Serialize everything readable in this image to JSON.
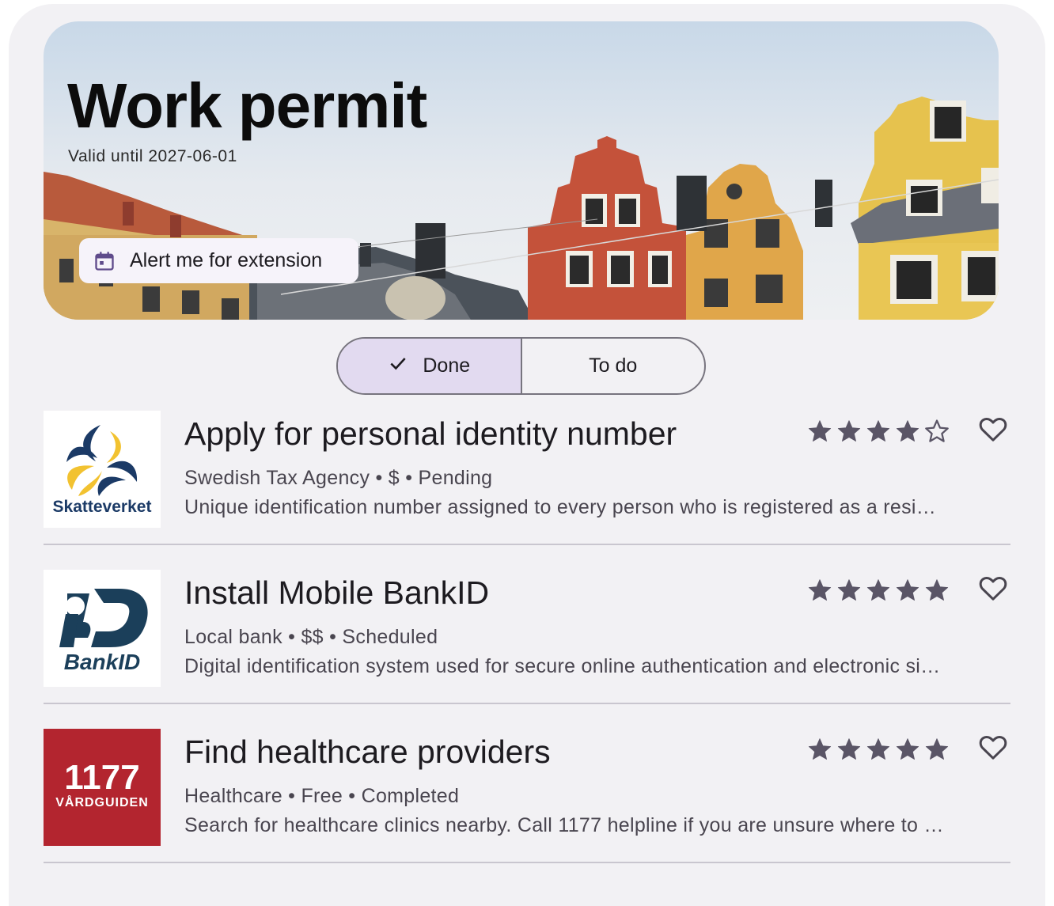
{
  "hero": {
    "title": "Work permit",
    "subtitle": "Valid until 2027-06-01",
    "alert_button": {
      "label": "Alert me for extension",
      "icon": "calendar-icon"
    }
  },
  "segmented": {
    "options": [
      {
        "label": "Done",
        "selected": true,
        "icon": "check-icon"
      },
      {
        "label": "To do",
        "selected": false
      }
    ]
  },
  "tasks": [
    {
      "title": "Apply for personal identity number",
      "meta": "Swedish Tax Agency • $ • Pending",
      "description": "Unique identification number assigned to every person who is registered as a resident in Sweden, used for taxes and services",
      "rating": 4,
      "rating_max": 5,
      "logo": {
        "name": "skatteverket-logo",
        "text": "Skatteverket"
      }
    },
    {
      "title": "Install Mobile BankID",
      "meta": "Local bank • $$ • Scheduled",
      "description": "Digital identification system used for secure online authentication and electronic signatures",
      "rating": 5,
      "rating_max": 5,
      "logo": {
        "name": "bankid-logo",
        "text": "BankID"
      }
    },
    {
      "title": "Find healthcare providers",
      "meta": "Healthcare • Free • Completed",
      "description": "Search for healthcare clinics nearby. Call 1177 helpline if you are unsure where to go",
      "rating": 5,
      "rating_max": 5,
      "logo": {
        "name": "1177-vardguiden-logo",
        "text": "1177 VÅRDGUIDEN"
      }
    }
  ],
  "colors": {
    "background": "#f2f1f4",
    "selected_segment": "#e2daf0",
    "star": "#5a5566",
    "vardguiden_red": "#b3252f",
    "bankid_blue": "#1b3f5a",
    "skatteverket_yellow": "#f2c230"
  }
}
